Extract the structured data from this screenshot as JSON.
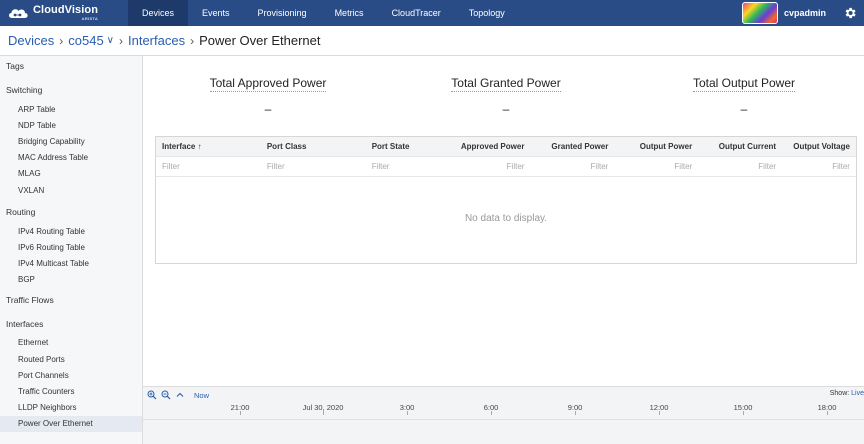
{
  "nav": {
    "logo_title": "CloudVision",
    "logo_sub": "ARISTA",
    "items": [
      "Devices",
      "Events",
      "Provisioning",
      "Metrics",
      "CloudTracer",
      "Topology"
    ],
    "active": "Devices",
    "username": "cvpadmin",
    "settings_icon": "gear-icon"
  },
  "breadcrumb": {
    "devices": "Devices",
    "device": "co545",
    "interfaces": "Interfaces",
    "current": "Power Over Ethernet"
  },
  "sidebar": {
    "tags": "Tags",
    "switching": "Switching",
    "switching_items": [
      "ARP Table",
      "NDP Table",
      "Bridging Capability",
      "MAC Address Table",
      "MLAG",
      "VXLAN"
    ],
    "routing": "Routing",
    "routing_items": [
      "IPv4 Routing Table",
      "IPv6 Routing Table",
      "IPv4 Multicast Table",
      "BGP"
    ],
    "traffic_flows": "Traffic Flows",
    "interfaces": "Interfaces",
    "interfaces_items": [
      "Ethernet",
      "Routed Ports",
      "Port Channels",
      "Traffic Counters",
      "LLDP Neighbors",
      "Power Over Ethernet"
    ]
  },
  "summary": [
    {
      "label": "Total Approved Power",
      "value": "–"
    },
    {
      "label": "Total Granted Power",
      "value": "–"
    },
    {
      "label": "Total Output Power",
      "value": "–"
    }
  ],
  "table": {
    "columns": [
      "Interface",
      "Port Class",
      "Port State",
      "Approved Power",
      "Granted Power",
      "Output Power",
      "Output Current",
      "Output Voltage"
    ],
    "sort_icon": "arrow-up-icon",
    "filter_placeholder": "Filter",
    "empty_message": "No data to display."
  },
  "timeline": {
    "now": "Now",
    "show_label": "Show:",
    "show_value": "Live",
    "ticks": [
      "21:00",
      "Jul 30, 2020",
      "3:00",
      "6:00",
      "9:00",
      "12:00",
      "15:00",
      "18:00"
    ]
  }
}
